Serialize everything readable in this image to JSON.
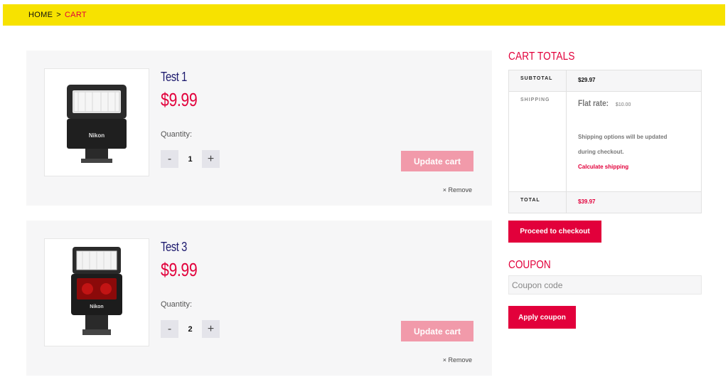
{
  "breadcrumb": {
    "home": "HOME",
    "separator": ">",
    "current": "CART"
  },
  "cart": {
    "items": [
      {
        "name": "Test 1",
        "price": "$9.99",
        "quantity_label": "Quantity:",
        "quantity": "1",
        "minus": "-",
        "plus": "+",
        "update_label": "Update cart",
        "remove_label": "× Remove",
        "image_brand": "Nikon",
        "image_icon": "camera-flash-small-icon"
      },
      {
        "name": "Test 3",
        "price": "$9.99",
        "quantity_label": "Quantity:",
        "quantity": "2",
        "minus": "-",
        "plus": "+",
        "update_label": "Update cart",
        "remove_label": "× Remove",
        "image_brand": "Nikon",
        "image_icon": "camera-flash-large-icon"
      }
    ]
  },
  "totals": {
    "title": "CART TOTALS",
    "subtotal_label": "SUBTOTAL",
    "subtotal_value": "$29.97",
    "shipping_label": "SHIPPING",
    "flat_rate_label": "Flat rate:",
    "flat_rate_value": "$10.00",
    "shipping_note": "Shipping options will be updated during checkout.",
    "calculate_label": "Calculate shipping",
    "total_label": "TOTAL",
    "total_value": "$39.97",
    "checkout_label": "Proceed to checkout"
  },
  "coupon": {
    "title": "COUPON",
    "placeholder": "Coupon code",
    "apply_label": "Apply coupon"
  },
  "colors": {
    "brand_yellow": "#f7e200",
    "accent_red": "#e2003b",
    "update_disabled": "#f19aaa",
    "item_bg": "#f6f6f7",
    "title_navy": "#1d1a6e"
  }
}
